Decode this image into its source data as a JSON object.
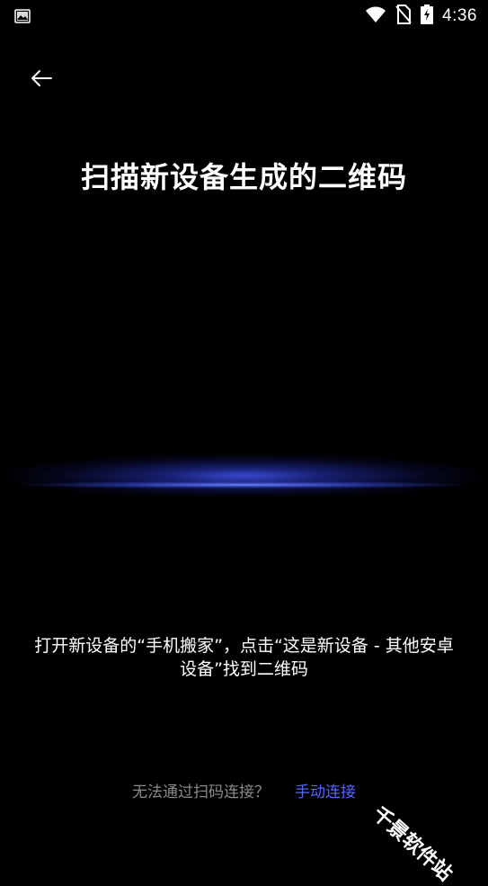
{
  "status_bar": {
    "time": "4:36",
    "icons": [
      "gallery-icon",
      "wifi-icon",
      "no-sim-icon",
      "battery-charging-icon"
    ]
  },
  "header": {
    "back_icon": "arrow-left-icon",
    "title": "扫描新设备生成的二维码"
  },
  "instruction": {
    "text": "打开新设备的“手机搬家”，点击“这是新设备 - 其他安卓设备”找到二维码"
  },
  "footer": {
    "cannot_connect": "无法通过扫码连接？",
    "manual_connect": "手动连接"
  },
  "watermark": {
    "text": "千景软件站"
  },
  "colors": {
    "background": "#000000",
    "accent": "#5566ff",
    "muted_text": "#8a8a8a",
    "scan_glow": "#3a4cff"
  }
}
